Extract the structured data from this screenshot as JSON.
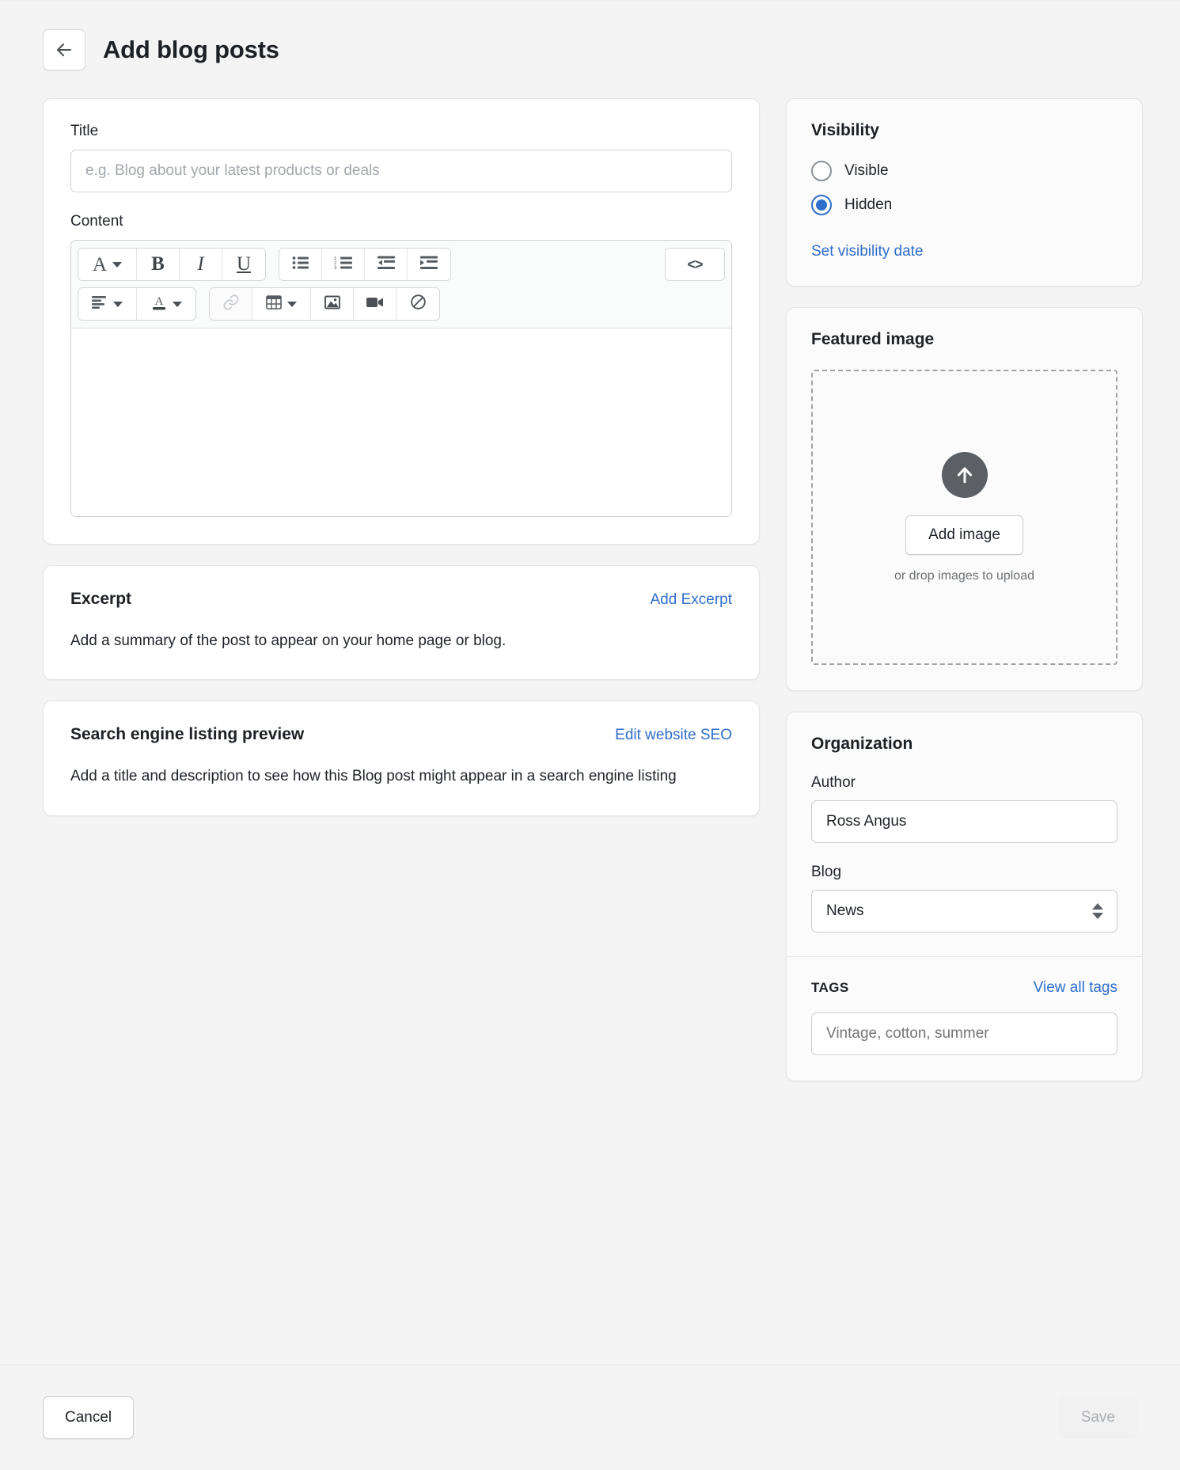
{
  "header": {
    "back_icon": "arrow-left-icon",
    "title": "Add blog posts"
  },
  "main": {
    "title_field": {
      "label": "Title",
      "value": "",
      "placeholder": "e.g. Blog about your latest products or deals"
    },
    "content_field": {
      "label": "Content",
      "value": "",
      "toolbar": {
        "row1": [
          {
            "name": "font-style-dropdown",
            "glyph": "A",
            "caret": true
          },
          {
            "name": "bold-button",
            "glyph": "B",
            "caret": false
          },
          {
            "name": "italic-button",
            "glyph": "I",
            "caret": false
          },
          {
            "name": "underline-button",
            "glyph": "U",
            "caret": false
          },
          {
            "name": "bullet-list-button",
            "glyph": "bullet-list-icon",
            "caret": false
          },
          {
            "name": "numbered-list-button",
            "glyph": "numbered-list-icon",
            "caret": false
          },
          {
            "name": "outdent-button",
            "glyph": "outdent-icon",
            "caret": false
          },
          {
            "name": "indent-button",
            "glyph": "indent-icon",
            "caret": false
          },
          {
            "name": "code-view-button",
            "glyph": "<>",
            "caret": false
          }
        ],
        "row2": [
          {
            "name": "align-dropdown",
            "glyph": "align-left-icon",
            "caret": true
          },
          {
            "name": "text-color-dropdown",
            "glyph": "text-color-icon",
            "caret": true
          },
          {
            "name": "insert-link-button",
            "glyph": "link-icon",
            "caret": false,
            "disabled": true
          },
          {
            "name": "insert-table-dropdown",
            "glyph": "table-icon",
            "caret": true
          },
          {
            "name": "insert-image-button",
            "glyph": "image-icon",
            "caret": false
          },
          {
            "name": "insert-video-button",
            "glyph": "video-icon",
            "caret": false
          },
          {
            "name": "clear-formatting-button",
            "glyph": "no-entry-icon",
            "caret": false
          }
        ]
      }
    },
    "excerpt": {
      "title": "Excerpt",
      "action": "Add Excerpt",
      "body": "Add a summary of the post to appear on your home page or blog."
    },
    "seo": {
      "title": "Search engine listing preview",
      "action": "Edit website SEO",
      "body": "Add a title and description to see how this Blog post might appear in a search engine listing"
    }
  },
  "sidebar": {
    "visibility": {
      "title": "Visibility",
      "options": [
        {
          "label": "Visible",
          "selected": false
        },
        {
          "label": "Hidden",
          "selected": true
        }
      ],
      "link": "Set visibility date"
    },
    "featured_image": {
      "title": "Featured image",
      "upload_icon": "upload-arrow-icon",
      "button": "Add image",
      "hint": "or drop images to upload"
    },
    "organization": {
      "title": "Organization",
      "author_label": "Author",
      "author_value": "Ross Angus",
      "blog_label": "Blog",
      "blog_value": "News",
      "tags_label": "TAGS",
      "tags_link": "View all tags",
      "tags_value": "",
      "tags_placeholder": "Vintage, cotton, summer"
    }
  },
  "footer": {
    "cancel": "Cancel",
    "save": "Save"
  },
  "colors": {
    "accent": "#2f6ecb",
    "page_bg": "#f4f4f4",
    "card_bg": "#ffffff",
    "text": "#20242a",
    "muted": "#6d7175",
    "upload_circle": "#5c6065",
    "save_disabled_bg": "#f1f1f1",
    "save_disabled_text": "#a9aeb2"
  }
}
